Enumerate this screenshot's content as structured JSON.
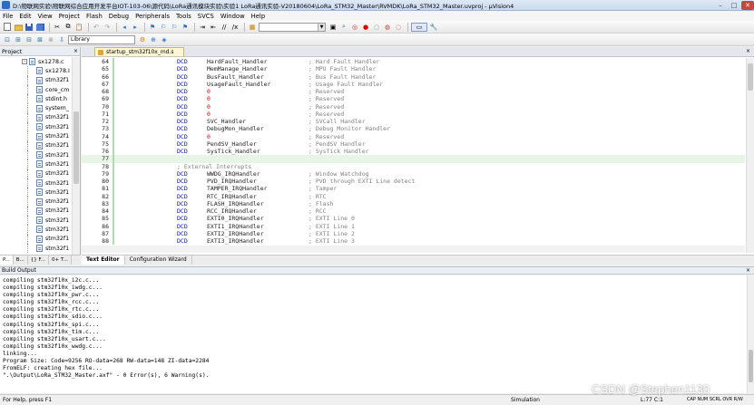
{
  "window": {
    "title": "D:\\物联网实验\\物联网综合应用开发平台IOT-103-06\\源代码\\LoRa通讯模块实验\\实验1 LoRa通讯实验-V20180604\\LoRa_STM32_Master\\RVMDK\\LoRa_STM32_Master.uvproj - µVision4",
    "minimize": "–",
    "maximize": "□",
    "close": "✕"
  },
  "menu": [
    "File",
    "Edit",
    "View",
    "Project",
    "Flash",
    "Debug",
    "Peripherals",
    "Tools",
    "SVCS",
    "Window",
    "Help"
  ],
  "toolbar": {
    "target_combo": "Library"
  },
  "project": {
    "title": "Project",
    "close": "×",
    "files": [
      "sx1278.c",
      "sx1278.I",
      "stm32f1",
      "core_cm",
      "stdint.h",
      "system_",
      "stm32f1",
      "stm32f1",
      "stm32f1",
      "stm32f1",
      "stm32f1",
      "stm32f1",
      "stm32f1",
      "stm32f1",
      "stm32f1",
      "stm32f1",
      "stm32f1",
      "stm32f1",
      "stm32f1",
      "stm32f1",
      "stm32f1",
      "stm32f1 *"
    ],
    "tabs": [
      "P...",
      "B...",
      "{} F...",
      "0+ T..."
    ]
  },
  "editor": {
    "tab": "startup_stm32f10x_md.s",
    "bottom_tabs": [
      "Text Editor",
      "Configuration Wizard"
    ],
    "lines": [
      {
        "n": "64",
        "kw": "DCD",
        "val": "HardFault_Handler",
        "cm": "; Hard Fault Handler"
      },
      {
        "n": "65",
        "kw": "DCD",
        "val": "MemManage_Handler",
        "cm": "; MPU Fault Handler"
      },
      {
        "n": "66",
        "kw": "DCD",
        "val": "BusFault_Handler",
        "cm": "; Bus Fault Handler"
      },
      {
        "n": "67",
        "kw": "DCD",
        "val": "UsageFault_Handler",
        "cm": "; Usage Fault Handler"
      },
      {
        "n": "68",
        "kw": "DCD",
        "val": "0",
        "cm": "; Reserved"
      },
      {
        "n": "69",
        "kw": "DCD",
        "val": "0",
        "cm": "; Reserved"
      },
      {
        "n": "70",
        "kw": "DCD",
        "val": "0",
        "cm": "; Reserved"
      },
      {
        "n": "71",
        "kw": "DCD",
        "val": "0",
        "cm": "; Reserved"
      },
      {
        "n": "72",
        "kw": "DCD",
        "val": "SVC_Handler",
        "cm": "; SVCall Handler"
      },
      {
        "n": "73",
        "kw": "DCD",
        "val": "DebugMon_Handler",
        "cm": "; Debug Monitor Handler"
      },
      {
        "n": "74",
        "kw": "DCD",
        "val": "0",
        "cm": "; Reserved"
      },
      {
        "n": "75",
        "kw": "DCD",
        "val": "PendSV_Handler",
        "cm": "; PendSV Handler"
      },
      {
        "n": "76",
        "kw": "DCD",
        "val": "SysTick_Handler",
        "cm": "; SysTick Handler"
      },
      {
        "n": "77",
        "kw": "",
        "val": "",
        "cm": ""
      },
      {
        "n": "78",
        "kw": "",
        "val": "",
        "cm": "; External Interrupts"
      },
      {
        "n": "79",
        "kw": "DCD",
        "val": "WWDG_IRQHandler",
        "cm": "; Window Watchdog"
      },
      {
        "n": "80",
        "kw": "DCD",
        "val": "PVD_IRQHandler",
        "cm": "; PVD through EXTI Line detect"
      },
      {
        "n": "81",
        "kw": "DCD",
        "val": "TAMPER_IRQHandler",
        "cm": "; Tamper"
      },
      {
        "n": "82",
        "kw": "DCD",
        "val": "RTC_IRQHandler",
        "cm": "; RTC"
      },
      {
        "n": "83",
        "kw": "DCD",
        "val": "FLASH_IRQHandler",
        "cm": "; Flash"
      },
      {
        "n": "84",
        "kw": "DCD",
        "val": "RCC_IRQHandler",
        "cm": "; RCC"
      },
      {
        "n": "85",
        "kw": "DCD",
        "val": "EXTI0_IRQHandler",
        "cm": "; EXTI Line 0"
      },
      {
        "n": "86",
        "kw": "DCD",
        "val": "EXTI1_IRQHandler",
        "cm": "; EXTI Line 1"
      },
      {
        "n": "87",
        "kw": "DCD",
        "val": "EXTI2_IRQHandler",
        "cm": "; EXTI Line 2"
      },
      {
        "n": "88",
        "kw": "DCD",
        "val": "EXTI3_IRQHandler",
        "cm": "; EXTI Line 3"
      }
    ]
  },
  "build": {
    "title": "Build Output",
    "close": "×",
    "lines": [
      "compiling stm32f10x_i2c.c...",
      "compiling stm32f10x_iwdg.c...",
      "compiling stm32f10x_pwr.c...",
      "compiling stm32f10x_rcc.c...",
      "compiling stm32f10x_rtc.c...",
      "compiling stm32f10x_sdio.c...",
      "compiling stm32f10x_spi.c...",
      "compiling stm32f10x_tim.c...",
      "compiling stm32f10x_usart.c...",
      "compiling stm32f10x_wwdg.c...",
      "linking...",
      "Program Size: Code=9256 RO-data=268 RW-data=148 ZI-data=2284",
      "FromELF: creating hex file...",
      "\".\\Output\\LoRa_STM32_Master.axf\" - 0 Error(s), 6 Warning(s)."
    ]
  },
  "status": {
    "help": "For Help, press F1",
    "mode": "Simulation",
    "position": "L:77 C:1",
    "flags": "CAP  NUM  SCRL  OVR  R/W"
  },
  "watermark": "CSDN @Stephen1130"
}
